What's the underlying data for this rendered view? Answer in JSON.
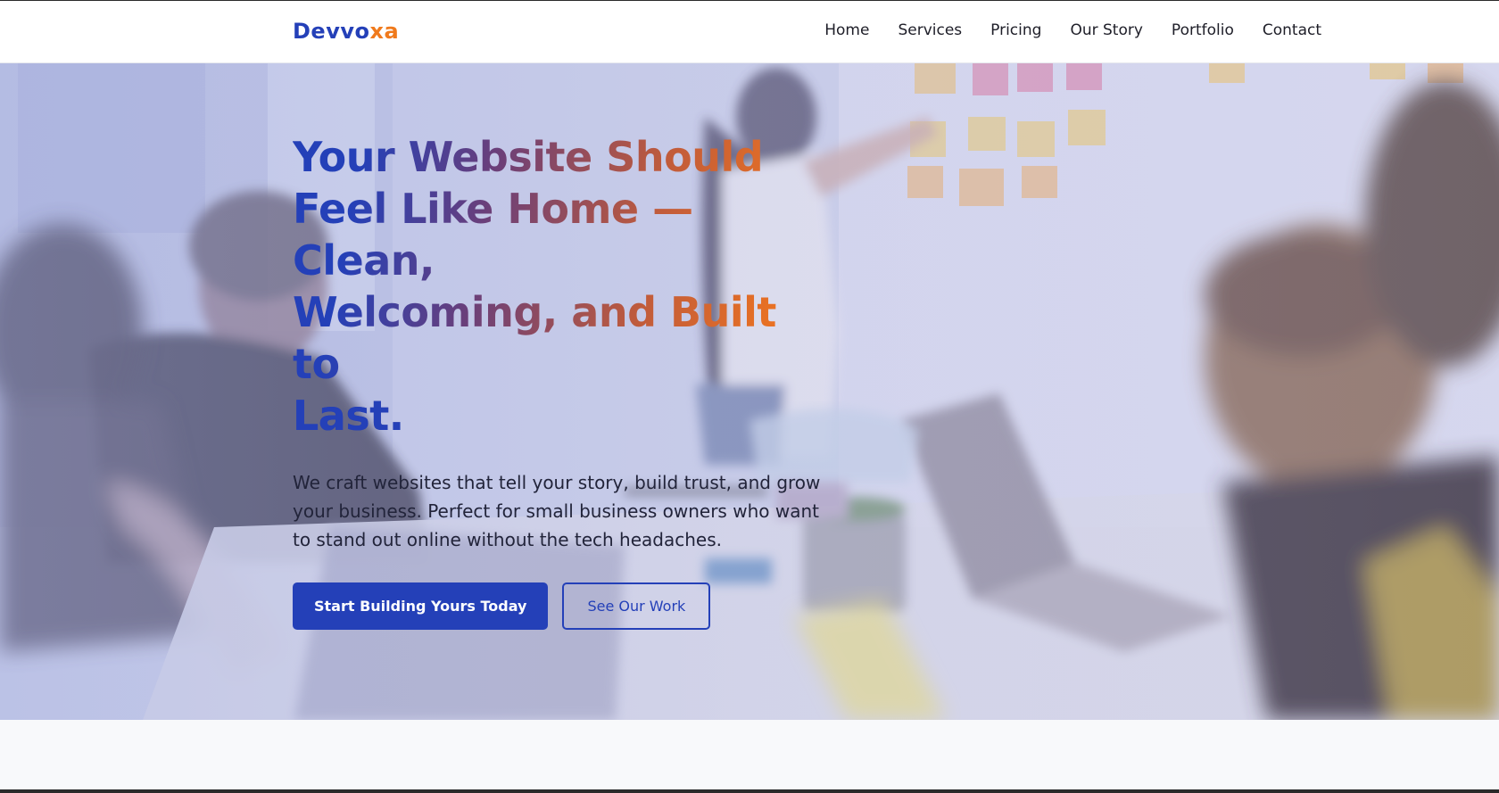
{
  "brand": {
    "part1": "Devvo",
    "part2": "xa",
    "primary_color": "#2440b8",
    "accent_color": "#f07a1c"
  },
  "nav": {
    "items": [
      "Home",
      "Services",
      "Pricing",
      "Our Story",
      "Portfolio",
      "Contact"
    ]
  },
  "hero": {
    "headline_lines": [
      "Your Website Should",
      "Feel Like Home — Clean,",
      "Welcoming, and Built to",
      "Last."
    ],
    "subtitle": "We craft websites that tell your story, build trust, and grow your business. Perfect for small business owners who want to stand out online without the tech headaches.",
    "primary_button": "Start Building Yours Today",
    "secondary_button": "See Our Work",
    "background_image": "office-team-meeting-photo"
  }
}
